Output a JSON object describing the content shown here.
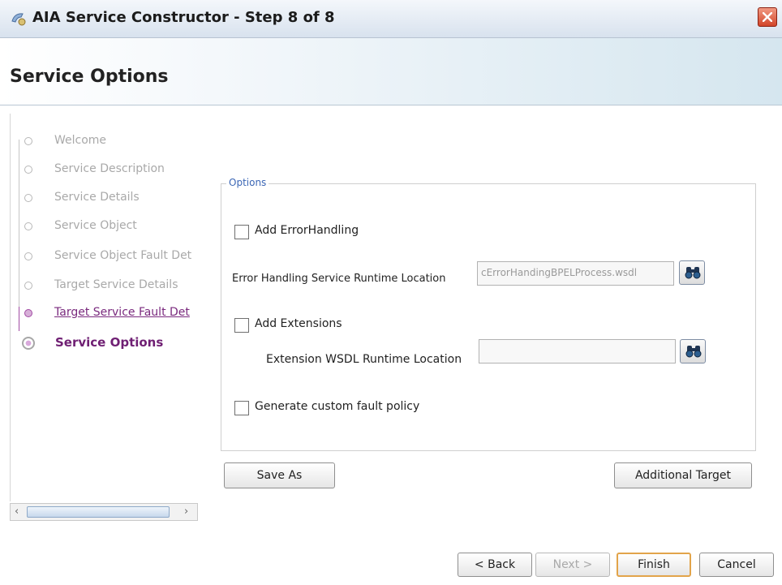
{
  "window": {
    "title": "AIA Service Constructor - Step 8 of 8"
  },
  "header": {
    "title": "Service Options"
  },
  "nav": {
    "items": [
      {
        "label": "Welcome",
        "state": "pending"
      },
      {
        "label": "Service Description",
        "state": "pending"
      },
      {
        "label": "Service Details",
        "state": "pending"
      },
      {
        "label": "Service Object",
        "state": "pending"
      },
      {
        "label": "Service Object Fault Det",
        "state": "pending"
      },
      {
        "label": "Target Service Details",
        "state": "pending"
      },
      {
        "label": "Target Service Fault Det",
        "state": "visited"
      },
      {
        "label": "Service Options",
        "state": "current"
      }
    ]
  },
  "options": {
    "legend": "Options",
    "add_error_handling": {
      "label": "Add ErrorHandling",
      "checked": false
    },
    "error_handling_location": {
      "label": "Error Handling Service Runtime Location",
      "value": "​cErrorHandingBPELProcess.wsdl"
    },
    "add_extensions": {
      "label": "Add Extensions",
      "checked": false
    },
    "extension_location": {
      "label": "Extension WSDL Runtime Location",
      "value": ""
    },
    "custom_fault_policy": {
      "label": "Generate custom fault policy",
      "checked": false
    }
  },
  "actions": {
    "save_as": "Save As",
    "additional_target": "Additional Target"
  },
  "footer": {
    "back": "< Back",
    "next": "Next >",
    "finish": "Finish",
    "cancel": "Cancel"
  },
  "colors": {
    "accent": "#6f1f73",
    "legend": "#3b66b5",
    "default_button_border": "#e2a44a"
  },
  "icons": {
    "app": "constructor-icon",
    "close": "close-icon",
    "browse": "binoculars-icon"
  }
}
